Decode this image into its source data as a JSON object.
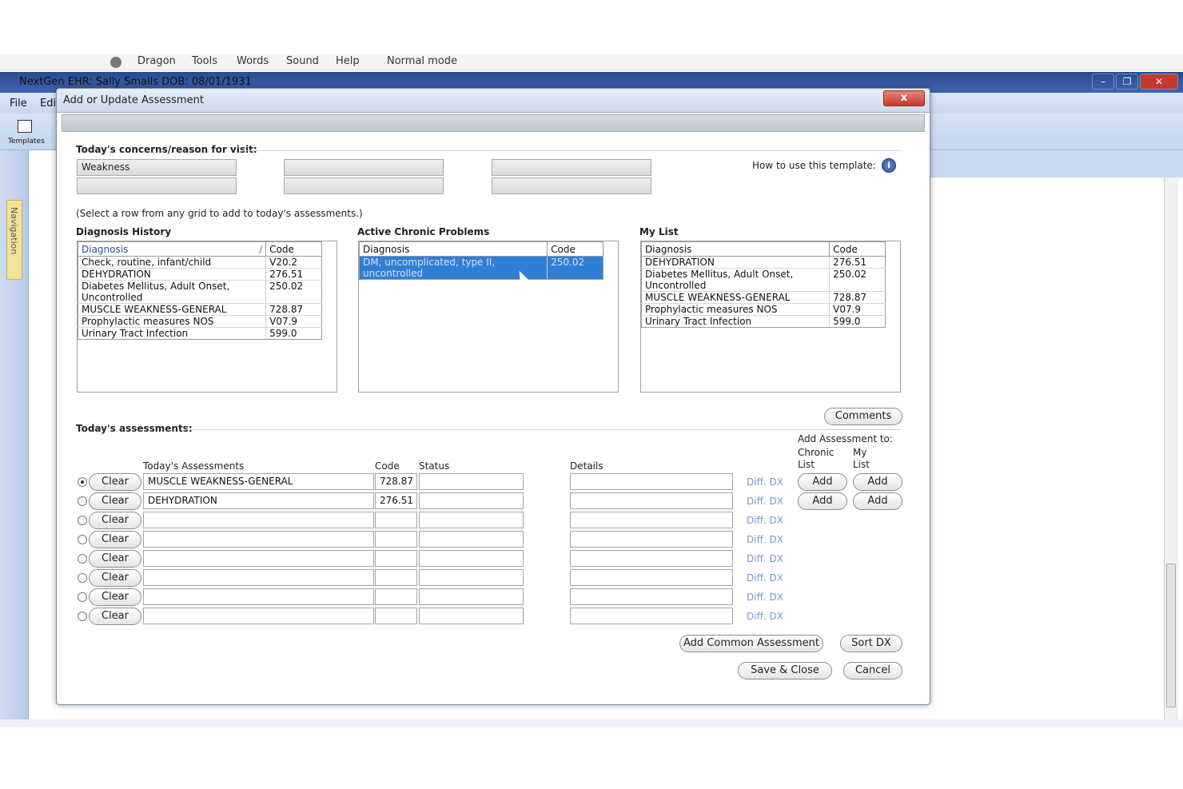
{
  "dragon_bar": {
    "items": [
      "Dragon",
      "Tools",
      "Words",
      "Sound",
      "Help"
    ],
    "mode": "Normal mode"
  },
  "app": {
    "title": "NextGen EHR: Sally Smalls  DOB: 08/01/1931",
    "menu": [
      "File",
      "Edi"
    ],
    "toolbar_label": "Templates",
    "nav_label": "Navigation"
  },
  "dialog": {
    "title": "Add or Update Assessment",
    "close": "x",
    "concerns": {
      "heading": "Today's concerns/reason for visit:",
      "fields": [
        "Weakness",
        "",
        "",
        "",
        "",
        ""
      ],
      "help_text": "How to use this template:",
      "help_icon": "i"
    },
    "instruction": "(Select a row from any grid to add to today's assessments.)",
    "diagnosis_history": {
      "title": "Diagnosis History",
      "headers": [
        "Diagnosis",
        "Code"
      ],
      "rows": [
        [
          "Check, routine, infant/child",
          "V20.2"
        ],
        [
          "DEHYDRATION",
          "276.51"
        ],
        [
          "Diabetes Mellitus, Adult Onset, Uncontrolled",
          "250.02"
        ],
        [
          "MUSCLE WEAKNESS-GENERAL",
          "728.87"
        ],
        [
          "Prophylactic measures NOS",
          "V07.9"
        ],
        [
          "Urinary Tract Infection",
          "599.0"
        ]
      ]
    },
    "chronic_problems": {
      "title": "Active Chronic Problems",
      "headers": [
        "Diagnosis",
        "Code"
      ],
      "rows": [
        [
          "DM, uncomplicated, type II, uncontrolled",
          "250.02"
        ]
      ]
    },
    "my_list": {
      "title": "My List",
      "headers": [
        "Diagnosis",
        "Code"
      ],
      "rows": [
        [
          "DEHYDRATION",
          "276.51"
        ],
        [
          "Diabetes Mellitus, Adult Onset, Uncontrolled",
          "250.02"
        ],
        [
          "MUSCLE WEAKNESS-GENERAL",
          "728.87"
        ],
        [
          "Prophylactic measures NOS",
          "V07.9"
        ],
        [
          "Urinary Tract Infection",
          "599.0"
        ]
      ]
    },
    "assessments": {
      "heading": "Today's assessments:",
      "comments_button": "Comments",
      "add_to_label": "Add Assessment to:",
      "chronic_list_label": "Chronic List",
      "my_list_label": "My List",
      "headers": {
        "assessment": "Today's Assessments",
        "code": "Code",
        "status": "Status",
        "details": "Details"
      },
      "clear_label": "Clear",
      "diff_label": "Diff. DX",
      "add_label": "Add",
      "rows": [
        {
          "assessment": "MUSCLE WEAKNESS-GENERAL",
          "code": "728.87",
          "status": "",
          "details": "",
          "selected": true
        },
        {
          "assessment": "DEHYDRATION",
          "code": "276.51",
          "status": "",
          "details": "",
          "selected": false
        },
        {
          "assessment": "",
          "code": "",
          "status": "",
          "details": "",
          "selected": false
        },
        {
          "assessment": "",
          "code": "",
          "status": "",
          "details": "",
          "selected": false
        },
        {
          "assessment": "",
          "code": "",
          "status": "",
          "details": "",
          "selected": false
        },
        {
          "assessment": "",
          "code": "",
          "status": "",
          "details": "",
          "selected": false
        },
        {
          "assessment": "",
          "code": "",
          "status": "",
          "details": "",
          "selected": false
        },
        {
          "assessment": "",
          "code": "",
          "status": "",
          "details": "",
          "selected": false
        }
      ]
    },
    "buttons": {
      "add_common": "Add Common Assessment",
      "sort_dx": "Sort DX",
      "save_close": "Save & Close",
      "cancel": "Cancel"
    }
  }
}
